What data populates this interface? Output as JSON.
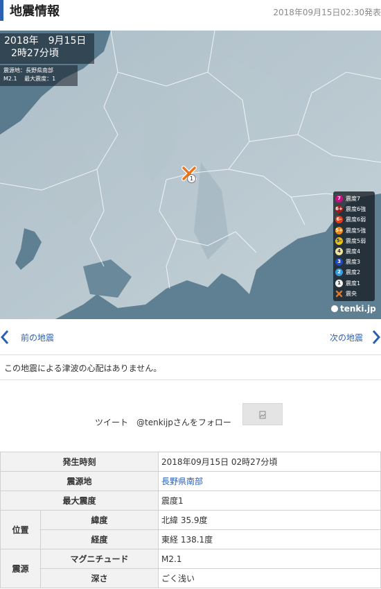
{
  "header": {
    "title": "地震情報",
    "timestamp": "2018年09月15日02:30発表"
  },
  "map": {
    "date_line1": "2018年　9月15日",
    "date_line2": "2時27分頃",
    "info_line1": "震源地：長野県南部",
    "info_line2": "M2.1　 最大震度：1",
    "intensity_mark": "1",
    "brand": "tenki.jp",
    "legend": [
      {
        "mark": "7",
        "label": "震度7",
        "color": "#c0127e"
      },
      {
        "mark": "6+",
        "label": "震度6強",
        "color": "#a01818"
      },
      {
        "mark": "6-",
        "label": "震度6弱",
        "color": "#e23d1e"
      },
      {
        "mark": "5+",
        "label": "震度5強",
        "color": "#e78a1e"
      },
      {
        "mark": "5-",
        "label": "震度5弱",
        "color": "#eac21a"
      },
      {
        "mark": "4",
        "label": "震度4",
        "color": "#f0e4a0"
      },
      {
        "mark": "3",
        "label": "震度3",
        "color": "#1f49c2"
      },
      {
        "mark": "2",
        "label": "震度2",
        "color": "#3a9ad8"
      },
      {
        "mark": "1",
        "label": "震度1",
        "color": "#f2f2f2"
      },
      {
        "mark": "",
        "label": "震央",
        "color": "#e8761e"
      }
    ]
  },
  "nav": {
    "prev_label": "前の地震",
    "next_label": "次の地震"
  },
  "tsunami_text": "この地震による津波の心配はありません。",
  "social": {
    "tweet_label": "ツイート",
    "follow_label": "@tenkijpさんをフォロー"
  },
  "table": {
    "occurred_label": "発生時刻",
    "occurred_value": "2018年09月15日 02時27分頃",
    "epicenter_label": "震源地",
    "epicenter_value": "長野県南部",
    "max_intensity_label": "最大震度",
    "max_intensity_value": "震度1",
    "position_label": "位置",
    "latitude_label": "緯度",
    "latitude_value": "北緯 35.9度",
    "longitude_label": "経度",
    "longitude_value": "東経 138.1度",
    "source_label": "震源",
    "magnitude_label": "マグニチュード",
    "magnitude_value": "M2.1",
    "depth_label": "深さ",
    "depth_value": "ごく浅い"
  }
}
